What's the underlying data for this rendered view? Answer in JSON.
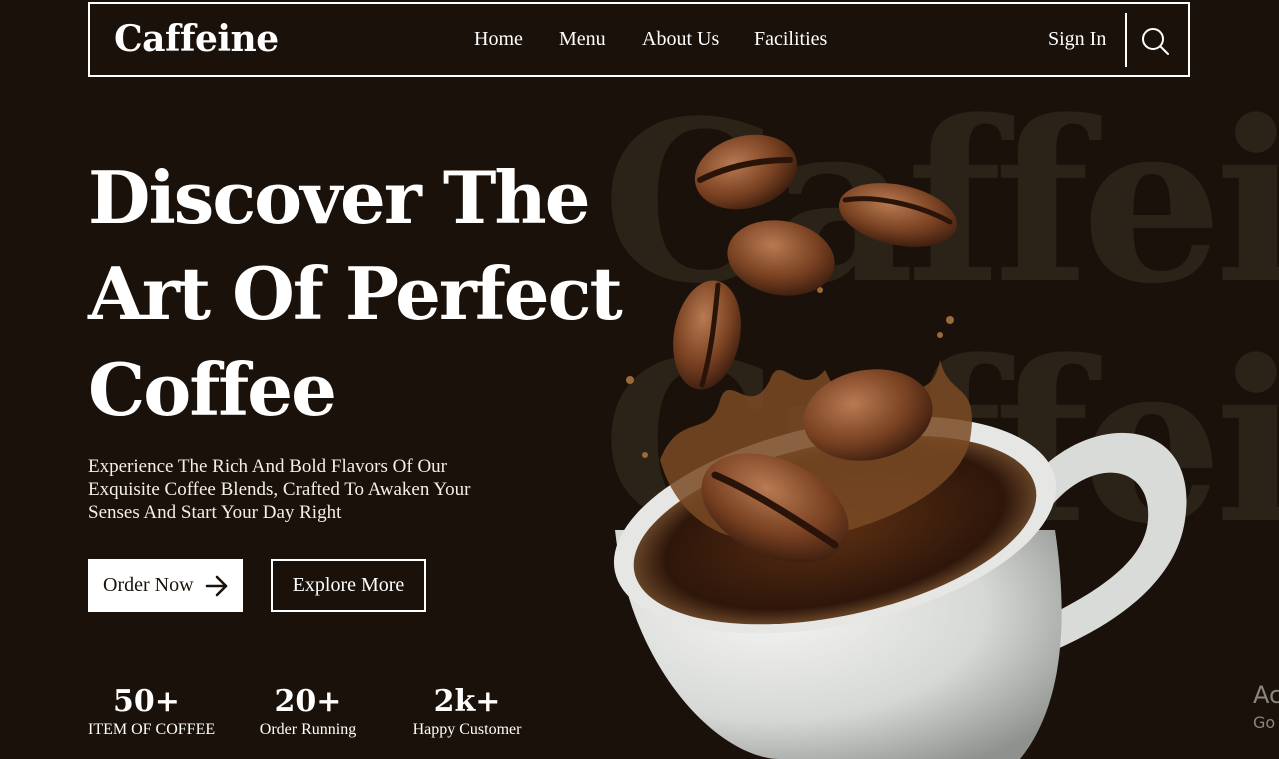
{
  "nav": {
    "brand": "Caffeine",
    "links": [
      "Home",
      "Menu",
      "About Us",
      "Facilities"
    ],
    "signin": "Sign In",
    "search_icon": "search-icon"
  },
  "watermark": {
    "text": "Caffein"
  },
  "hero": {
    "title_lines": [
      "Discover The",
      "Art Of Perfect",
      "Coffee"
    ],
    "description": "Experience The Rich And Bold Flavors Of Our Exquisite Coffee Blends, Crafted To Awaken Your Senses And Start Your Day Right",
    "order_button": "Order Now",
    "order_icon": "arrow-right-icon",
    "explore_button": "Explore More"
  },
  "stats": [
    {
      "value": "50+",
      "label": "ITEM OF COFFEE"
    },
    {
      "value": "20+",
      "label": "Order Running"
    },
    {
      "value": "2k+",
      "label": "Happy Customer"
    }
  ],
  "activate": {
    "line1": "Ac",
    "line2": "Go"
  },
  "colors": {
    "background": "#1a110a",
    "watermark": "#2b2218",
    "foreground": "#ffffff"
  }
}
